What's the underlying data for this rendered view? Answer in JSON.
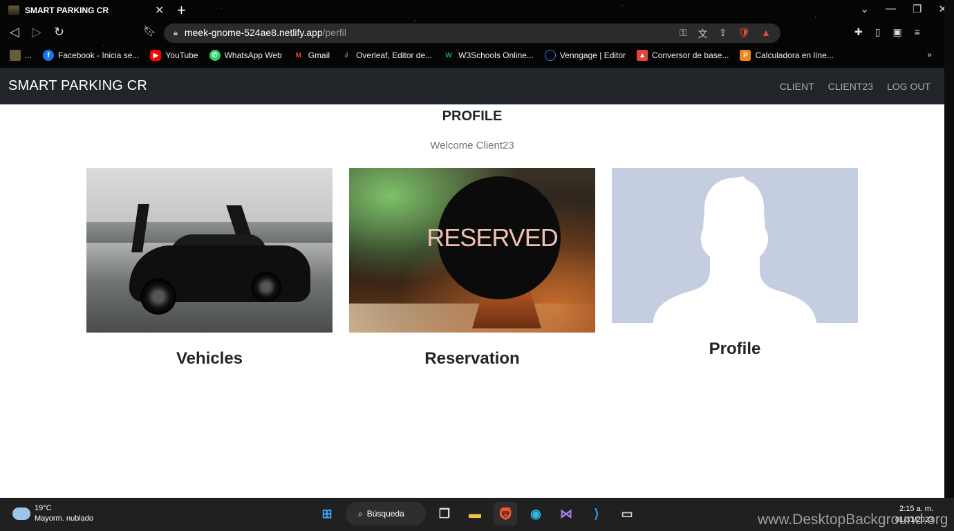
{
  "browser": {
    "tab_title": "SMART PARKING CR",
    "url_host": "meek-gnome-524ae8.netlify.app",
    "url_path": "/perfil",
    "bookmarks": [
      {
        "label": "...",
        "icon": "folder-icon",
        "color": "#6b5a3a"
      },
      {
        "label": "Facebook - Inicia se...",
        "icon": "facebook-icon",
        "color": "#1877f2"
      },
      {
        "label": "YouTube",
        "icon": "youtube-icon",
        "color": "#ff0000"
      },
      {
        "label": "WhatsApp Web",
        "icon": "whatsapp-icon",
        "color": "#25d366"
      },
      {
        "label": "Gmail",
        "icon": "gmail-icon",
        "color": "#ea4335"
      },
      {
        "label": "Overleaf, Editor de...",
        "icon": "overleaf-icon",
        "color": "#4f9c45"
      },
      {
        "label": "W3Schools Online...",
        "icon": "w3schools-icon",
        "color": "#04aa6d"
      },
      {
        "label": "Venngage | Editor",
        "icon": "venngage-icon",
        "color": "#3b82f6"
      },
      {
        "label": "Conversor de base...",
        "icon": "conversor-icon",
        "color": "#e0443b"
      },
      {
        "label": "Calculadora en líne...",
        "icon": "calculadora-icon",
        "color": "#f58220"
      }
    ],
    "bookmarks_more": "»"
  },
  "app": {
    "brand": "SMART PARKING CR",
    "nav": [
      "CLIENT",
      "CLIENT23",
      "LOG OUT"
    ],
    "page_title": "PROFILE",
    "welcome": "Welcome Client23",
    "cards": [
      {
        "label": "Vehicles"
      },
      {
        "label": "Reservation",
        "sign_text": "RESERVED"
      },
      {
        "label": "Profile"
      }
    ]
  },
  "taskbar": {
    "temperature": "19°C",
    "weather": "Mayorm. nublado",
    "search": "Búsqueda",
    "time": "2:15 a. m.",
    "date": "01/31/2023"
  },
  "watermark": "www.DesktopBackground.org",
  "colors": {
    "navbar": "#212529",
    "profile_bg": "#c5cde0",
    "brave": "#fb542b"
  }
}
